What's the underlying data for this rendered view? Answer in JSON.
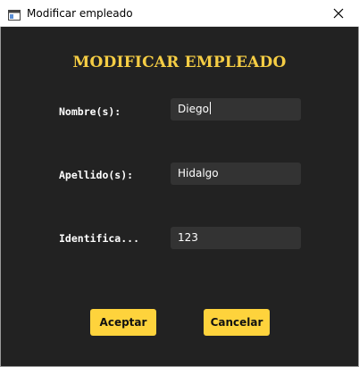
{
  "window": {
    "title": "Modificar empleado",
    "icon": "app-window-icon",
    "close_icon": "close-icon"
  },
  "form": {
    "heading": "MODIFICAR EMPLEADO",
    "fields": [
      {
        "label": "Nombre(s):",
        "value": "Diego",
        "focused": true
      },
      {
        "label": "Apellido(s):",
        "value": "Hidalgo",
        "focused": false
      },
      {
        "label": "Identifica...",
        "value": "123",
        "focused": false
      }
    ]
  },
  "buttons": {
    "accept": "Aceptar",
    "cancel": "Cancelar"
  },
  "colors": {
    "background": "#222222",
    "heading": "#f5cd44",
    "field_bg": "#333333",
    "button_bg": "#fed33c"
  }
}
